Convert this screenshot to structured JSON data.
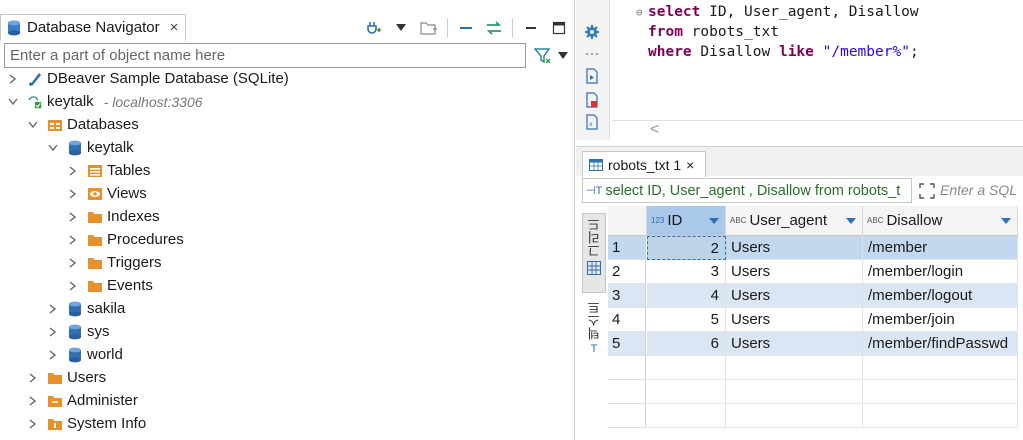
{
  "navigator": {
    "tab_label": "Database Navigator",
    "close_glyph": "×",
    "filter_placeholder": "Enter a part of object name here",
    "tree": [
      {
        "label": "DBeaver Sample Database (SQLite)",
        "icon": "sqlite-db-icon",
        "expanded": false
      },
      {
        "label": "keytalk",
        "host": " - localhost:3306",
        "icon": "mysql-connection-icon",
        "expanded": true
      },
      {
        "label": "Databases",
        "icon": "folder-icon",
        "expanded": true
      },
      {
        "label": "keytalk",
        "icon": "database-icon",
        "expanded": true
      },
      {
        "label": "Tables",
        "icon": "table-icon",
        "expanded": false
      },
      {
        "label": "Views",
        "icon": "view-icon",
        "expanded": false
      },
      {
        "label": "Indexes",
        "icon": "folder-icon",
        "expanded": false
      },
      {
        "label": "Procedures",
        "icon": "folder-icon",
        "expanded": false
      },
      {
        "label": "Triggers",
        "icon": "folder-icon",
        "expanded": false
      },
      {
        "label": "Events",
        "icon": "folder-icon",
        "expanded": false
      },
      {
        "label": "sakila",
        "icon": "database-icon",
        "expanded": false
      },
      {
        "label": "sys",
        "icon": "database-icon",
        "expanded": false
      },
      {
        "label": "world",
        "icon": "database-icon",
        "expanded": false
      },
      {
        "label": "Users",
        "icon": "folder-icon",
        "expanded": false
      },
      {
        "label": "Administer",
        "icon": "folder-icon",
        "expanded": false
      },
      {
        "label": "System Info",
        "icon": "folder-icon",
        "expanded": false
      }
    ]
  },
  "editor": {
    "line1_kw": "select",
    "line1_rest": " ID, User_agent, Disallow",
    "line2_kw": "from",
    "line2_rest": " robots_txt",
    "line3_kw1": "where",
    "line3_mid": " Disallow ",
    "line3_kw2": "like",
    "line3_str": "\"/member%\"",
    "line3_end": ";",
    "scroll_glyph": "<"
  },
  "results": {
    "tab_label": "robots_txt 1",
    "close_glyph": "×",
    "query_text": "select ID, User_agent , Disallow from robots_t",
    "filter_placeholder": "Enter a SQL",
    "side_tab_grid": "그리드",
    "side_tab_text": "텍스트",
    "columns": [
      {
        "label": "ID",
        "type_badge": "123"
      },
      {
        "label": "User_agent",
        "type_badge": "ABC"
      },
      {
        "label": "Disallow",
        "type_badge": "ABC"
      }
    ],
    "rows": [
      {
        "n": "1",
        "id": "2",
        "agent": "Users",
        "disallow": "/member"
      },
      {
        "n": "2",
        "id": "3",
        "agent": "Users",
        "disallow": "/member/login"
      },
      {
        "n": "3",
        "id": "4",
        "agent": "Users",
        "disallow": "/member/logout"
      },
      {
        "n": "4",
        "id": "5",
        "agent": "Users",
        "disallow": "/member/join"
      },
      {
        "n": "5",
        "id": "6",
        "agent": "Users",
        "disallow": "/member/findPasswd"
      }
    ]
  },
  "colors": {
    "accent": "#2f6fb3",
    "folder": "#e8912c",
    "keyword": "#7f0055",
    "string": "#2a00ff",
    "row_highlight": "#dbe6f4"
  }
}
